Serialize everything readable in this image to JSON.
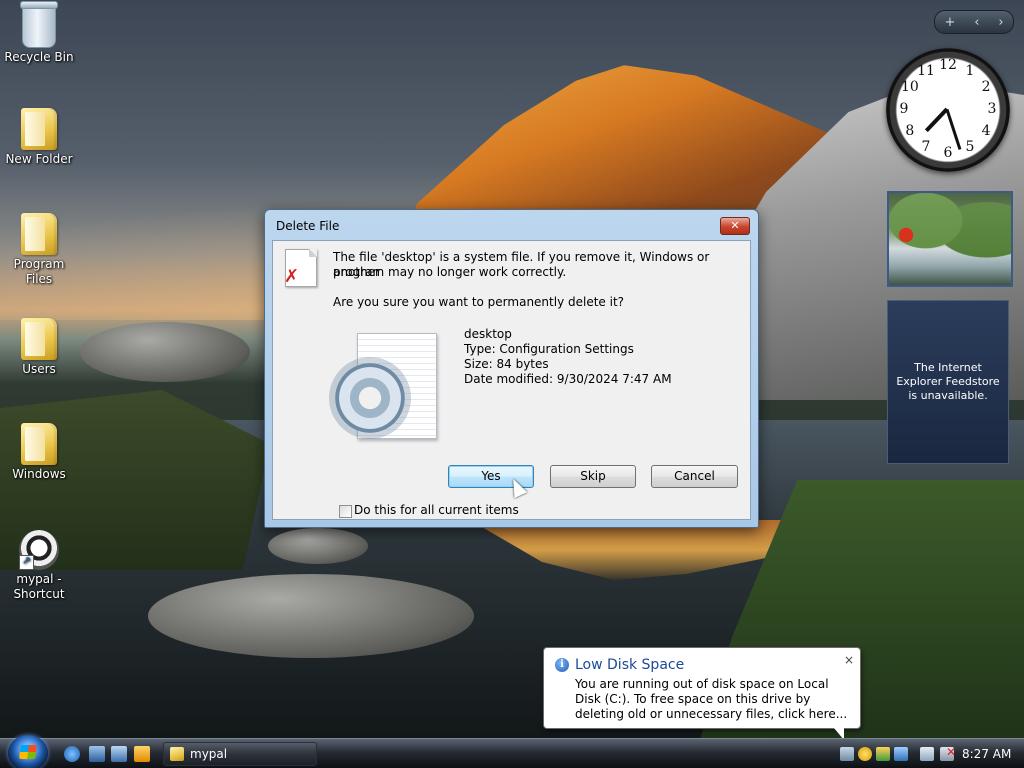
{
  "desktop": {
    "icons": [
      {
        "label": "Recycle Bin"
      },
      {
        "label": "New Folder"
      },
      {
        "label": "Program Files"
      },
      {
        "label": "Users"
      },
      {
        "label": "Windows"
      },
      {
        "label": "mypal - Shortcut"
      }
    ]
  },
  "gadgets": {
    "toolbar": {
      "add": "+",
      "prev": "‹",
      "next": "›"
    },
    "clock": {
      "hours": 7,
      "minutes": 27,
      "numerals": [
        "12",
        "1",
        "2",
        "3",
        "4",
        "5",
        "6",
        "7",
        "8",
        "9",
        "10",
        "11"
      ]
    },
    "feed_text": "The Internet Explorer Feedstore is unavailable."
  },
  "dialog": {
    "title": "Delete File",
    "close_glyph": "✕",
    "message_line1": "The file 'desktop' is a system file. If you remove it, Windows or another",
    "message_line2": "program may no longer work correctly.",
    "question": "Are you sure you want to permanently delete it?",
    "file": {
      "name": "desktop",
      "type": "Type: Configuration Settings",
      "size": "Size: 84 bytes",
      "modified": "Date modified: 9/30/2024 7:47 AM"
    },
    "buttons": {
      "yes": "Yes",
      "skip": "Skip",
      "cancel": "Cancel"
    },
    "checkbox_label": "Do this for all current items",
    "checkbox_checked": false
  },
  "notification": {
    "title": "Low Disk Space",
    "text": "You are running out of disk space on Local Disk (C:). To free space on this drive by deleting old or unnecessary files, click here...",
    "close_glyph": "×"
  },
  "taskbar": {
    "task_label": "mypal",
    "time": "8:27 AM"
  },
  "colors": {
    "accent": "#1b4a9a",
    "dialog_frame": "#a9c8e6",
    "close_red": "#c9442c"
  }
}
